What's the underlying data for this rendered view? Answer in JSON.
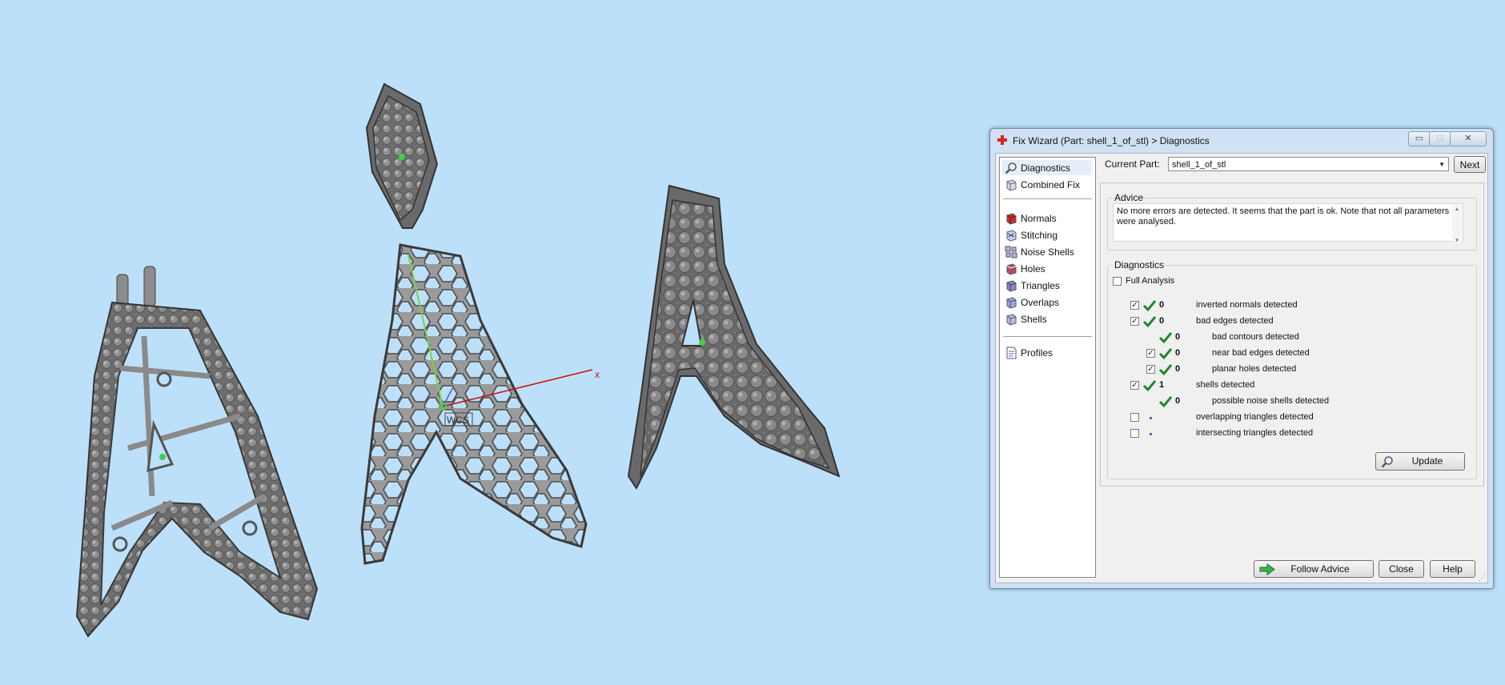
{
  "window": {
    "title": "Fix Wizard (Part: shell_1_of_stl) > Diagnostics",
    "minimize": "▭",
    "maximize": "□",
    "close": "✕"
  },
  "viewport": {
    "wcs_label": "WCS",
    "x_axis_label": "x"
  },
  "sidebar": {
    "items": [
      {
        "label": "Diagnostics",
        "icon": "magnifier-icon"
      },
      {
        "label": "Combined Fix",
        "icon": "cube-icon"
      },
      {
        "label": "Normals",
        "icon": "normals-icon"
      },
      {
        "label": "Stitching",
        "icon": "stitching-icon"
      },
      {
        "label": "Noise Shells",
        "icon": "noise-shells-icon"
      },
      {
        "label": "Holes",
        "icon": "holes-icon"
      },
      {
        "label": "Triangles",
        "icon": "triangles-icon"
      },
      {
        "label": "Overlaps",
        "icon": "overlaps-icon"
      },
      {
        "label": "Shells",
        "icon": "shells-icon"
      },
      {
        "label": "Profiles",
        "icon": "document-icon"
      }
    ]
  },
  "header": {
    "current_part_label": "Current Part:",
    "current_part_value": "shell_1_of_stl",
    "next_label": "Next"
  },
  "advice": {
    "title": "Advice",
    "text": "No more errors are detected. It seems that the part is ok. Note that not all parameters were analysed."
  },
  "diagnostics": {
    "title": "Diagnostics",
    "full_analysis_label": "Full Analysis",
    "full_analysis_checked": false,
    "rows": [
      {
        "count": "0",
        "label": "inverted normals detected",
        "checked": true,
        "status": "ok"
      },
      {
        "count": "0",
        "label": "bad edges detected",
        "checked": true,
        "status": "ok"
      },
      {
        "count": "0",
        "label": "bad contours detected",
        "checked": null,
        "status": "ok"
      },
      {
        "count": "0",
        "label": "near bad edges detected",
        "checked": true,
        "status": "ok"
      },
      {
        "count": "0",
        "label": "planar holes detected",
        "checked": true,
        "status": "ok"
      },
      {
        "count": "1",
        "label": "shells detected",
        "checked": true,
        "status": "ok"
      },
      {
        "count": "0",
        "label": "possible noise shells detected",
        "checked": null,
        "status": "ok"
      },
      {
        "count": "",
        "label": "overlapping triangles detected",
        "checked": false,
        "status": "pending"
      },
      {
        "count": "",
        "label": "intersecting triangles detected",
        "checked": false,
        "status": "pending"
      }
    ],
    "update_label": "Update"
  },
  "footer": {
    "follow_advice_label": "Follow Advice",
    "close_label": "Close",
    "help_label": "Help"
  },
  "colors": {
    "background": "#bde0fa",
    "ok_check": "#1d8a2a",
    "model_gray": "#7c7c7c",
    "x_axis": "#cc1111",
    "y_axis": "#7bd14a"
  }
}
